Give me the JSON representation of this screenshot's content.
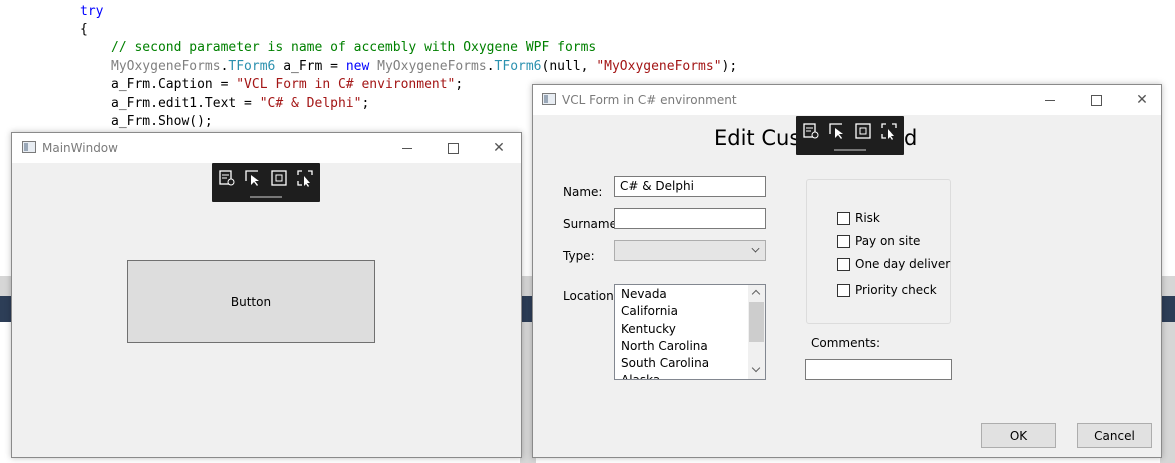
{
  "code": {
    "line1": "try",
    "line2": "{",
    "comment": "// second parameter is name of accembly with Oxygene WPF forms",
    "decl_ns": "MyOxygeneForms",
    "decl_dot1": ".",
    "decl_type": "TForm6",
    "decl_var": " a_Frm = ",
    "decl_new": "new",
    "decl_ns2": " MyOxygeneForms",
    "decl_dot2": ".",
    "decl_type2": "TForm6",
    "decl_args": "(null, ",
    "decl_str": "\"MyOxygeneForms\"",
    "decl_end": ");",
    "caption_lhs": "a_Frm.Caption = ",
    "caption_str": "\"VCL Form in C# environment\"",
    "caption_end": ";",
    "text_lhs": "a_Frm.edit1.Text = ",
    "text_str": "\"C# & Delphi\"",
    "text_end": ";",
    "show": "a_Frm.Show();"
  },
  "main_window": {
    "title": "MainWindow",
    "button_label": "Button",
    "close_glyph": "✕"
  },
  "vcl_form": {
    "title": "VCL Form in C# environment",
    "heading": "Edit Cust",
    "heading_tail": "d",
    "close_glyph": "✕",
    "labels": {
      "name": "Name:",
      "surname": "Surname:",
      "type": "Type:",
      "location": "Location:",
      "comments": "Comments:"
    },
    "fields": {
      "name_value": "C# & Delphi",
      "surname_value": "",
      "type_value": "",
      "comments_value": ""
    },
    "locations": [
      "Nevada",
      "California",
      "Kentucky",
      "North Carolina",
      "South Carolina",
      "Alaska"
    ],
    "checkboxes": [
      {
        "label": "Risk",
        "checked": false
      },
      {
        "label": "Pay on site",
        "checked": false
      },
      {
        "label": "One day deliver",
        "checked": false
      },
      {
        "label": "Priority check",
        "checked": false
      }
    ],
    "ok_label": "OK",
    "cancel_label": "Cancel"
  },
  "icons": {
    "toolbar": [
      "live-visual-tree-icon",
      "select-element-icon",
      "display-layout-adorners-icon",
      "track-focus-icon"
    ],
    "window": "app-window-icon"
  },
  "colors": {
    "keyword": "#0000ff",
    "comment": "#008000",
    "type": "#2b91af",
    "string": "#a31515",
    "toolbar_bg": "#1e1e1e"
  }
}
